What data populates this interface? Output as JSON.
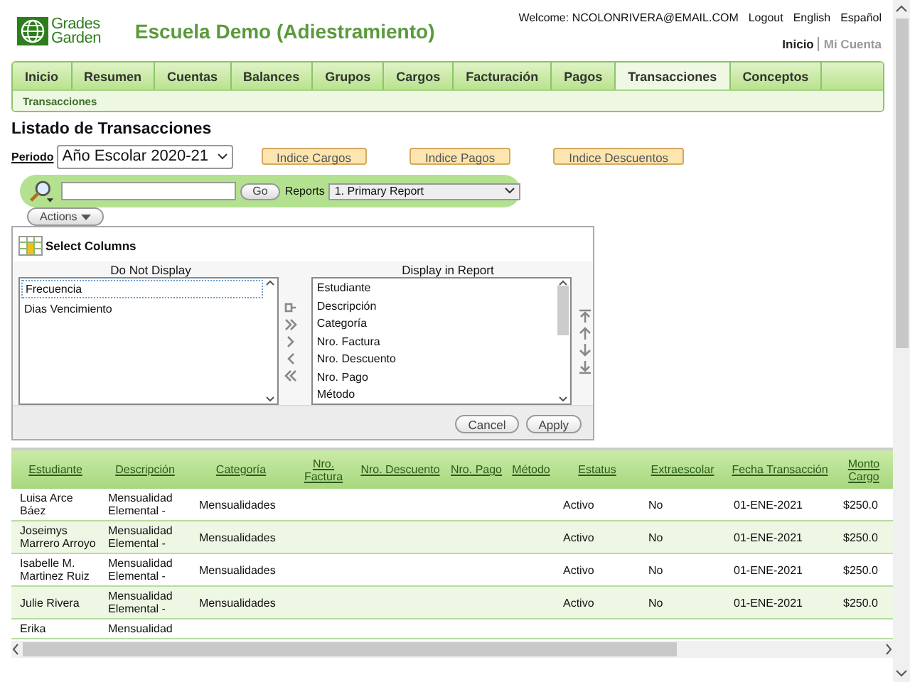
{
  "header": {
    "logo": [
      "Grades",
      "Garden"
    ],
    "school": "Escuela Demo (Adiestramiento)",
    "welcome": "Welcome: NCOLONRIVERA@EMAIL.COM",
    "links": [
      "Logout",
      "English",
      "Español"
    ],
    "account_links": [
      {
        "label": "Inicio",
        "selected": true
      },
      {
        "label": "Mi Cuenta",
        "selected": false
      }
    ]
  },
  "nav": {
    "tabs": [
      {
        "label": "Inicio",
        "selected": false
      },
      {
        "label": "Resumen",
        "selected": false
      },
      {
        "label": "Cuentas",
        "selected": false
      },
      {
        "label": "Balances",
        "selected": false
      },
      {
        "label": "Grupos",
        "selected": false
      },
      {
        "label": "Cargos",
        "selected": false
      },
      {
        "label": "Facturación",
        "selected": false
      },
      {
        "label": "Pagos",
        "selected": false
      },
      {
        "label": "Transacciones",
        "selected": true
      },
      {
        "label": "Conceptos",
        "selected": false
      }
    ],
    "subtabs": [
      "Transacciones"
    ]
  },
  "page_title": "Listado de Transacciones",
  "period": {
    "label": "Periodo",
    "value": "Año Escolar 2020-21"
  },
  "index_buttons": [
    "Indice Cargos",
    "Indice Pagos",
    "Indice Descuentos"
  ],
  "search": {
    "go": "Go",
    "reports_label": "Reports",
    "report": "1. Primary Report",
    "actions": "Actions"
  },
  "select_columns": {
    "title": "Select Columns",
    "hidden_label": "Do Not Display",
    "hidden": [
      {
        "label": "Frecuencia",
        "selected": true
      },
      {
        "label": "Dias Vencimiento",
        "selected": false
      }
    ],
    "shown_label": "Display in Report",
    "shown": [
      {
        "label": "Estudiante",
        "selected": false
      },
      {
        "label": "Descripción",
        "selected": false
      },
      {
        "label": "Categoría",
        "selected": false
      },
      {
        "label": "Nro. Factura",
        "selected": false
      },
      {
        "label": "Nro. Descuento",
        "selected": false
      },
      {
        "label": "Nro. Pago",
        "selected": false
      },
      {
        "label": "Método",
        "selected": false
      }
    ],
    "buttons": [
      "Cancel",
      "Apply"
    ]
  },
  "table": {
    "columns": [
      "Estudiante",
      "Descripción",
      "Categoría",
      "Nro. Factura",
      "Nro. Descuento",
      "Nro. Pago",
      "Método",
      "Estatus",
      "Extraescolar",
      "Fecha Transacción",
      "Monto Cargo"
    ],
    "rows": [
      [
        "Luisa Arce Báez",
        "Mensualidad Elemental -",
        "Mensualidades",
        "",
        "",
        "",
        "",
        "Activo",
        "No",
        "01-ENE-2021",
        "$250.0"
      ],
      [
        "Joseimys Marrero Arroyo",
        "Mensualidad Elemental -",
        "Mensualidades",
        "",
        "",
        "",
        "",
        "Activo",
        "No",
        "01-ENE-2021",
        "$250.0"
      ],
      [
        "Isabelle M. Martinez Ruiz",
        "Mensualidad Elemental -",
        "Mensualidades",
        "",
        "",
        "",
        "",
        "Activo",
        "No",
        "01-ENE-2021",
        "$250.0"
      ],
      [
        "Julie Rivera",
        "Mensualidad Elemental -",
        "Mensualidades",
        "",
        "",
        "",
        "",
        "Activo",
        "No",
        "01-ENE-2021",
        "$250.0"
      ],
      [
        "Erika",
        "Mensualidad"
      ]
    ]
  }
}
